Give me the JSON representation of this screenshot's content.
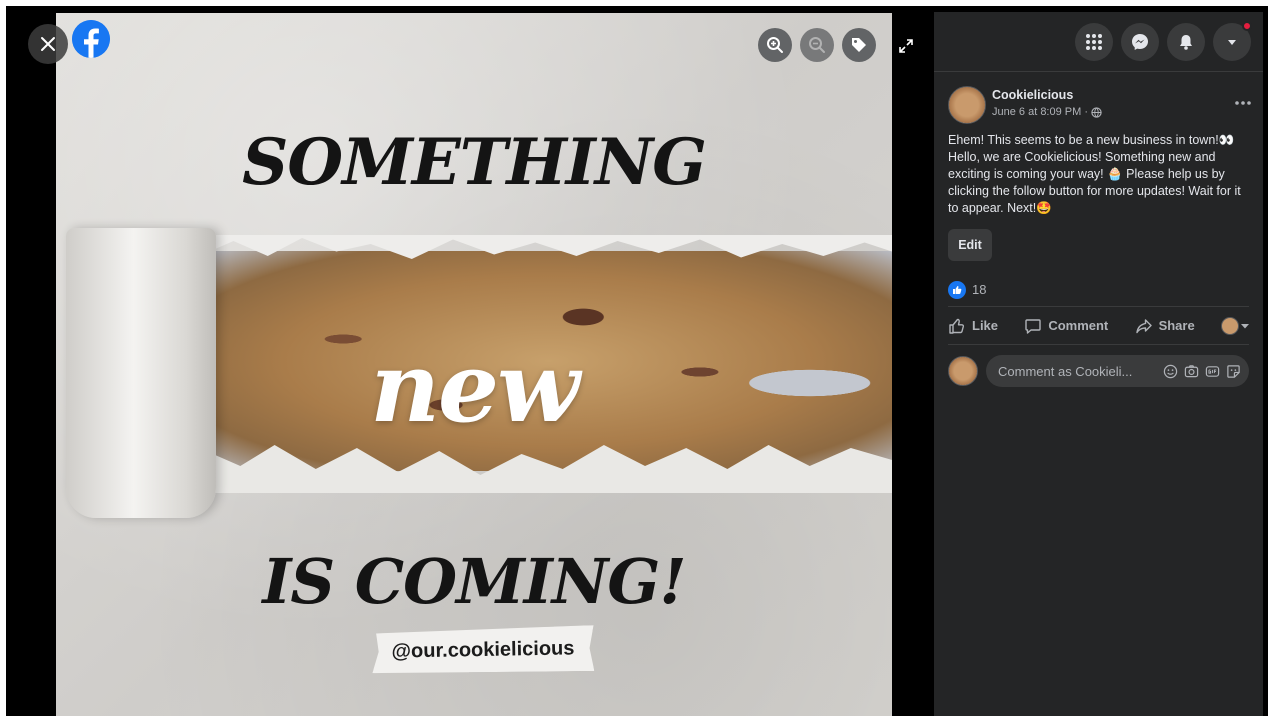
{
  "photo": {
    "headline_top": "SOMETHING",
    "headline_middle": "new",
    "headline_bottom": "IS COMING!",
    "handle": "@our.cookielicious"
  },
  "viewer_controls": {
    "close_icon": "close-icon",
    "logo_icon": "facebook-logo-icon",
    "tools": [
      "zoom-in-icon",
      "zoom-out-icon",
      "tag-icon"
    ],
    "expand_icon": "expand-icon"
  },
  "topbar": {
    "icons": [
      "menu-grid-icon",
      "messenger-icon",
      "bell-icon",
      "chevron-down-icon"
    ],
    "notification_color": "#e41e3f"
  },
  "post": {
    "page_name": "Cookielicious",
    "timestamp": "June 6 at 8:09 PM ·",
    "text": "Ehem! This seems to be a new business in town!👀 Hello, we are Cookielicious! Something new and exciting is coming your way! 🧁 Please help us by clicking the follow button for more updates! Wait for it to appear. Next!🤩",
    "edit_label": "Edit",
    "reaction_count": "18",
    "actions": {
      "like": "Like",
      "comment": "Comment",
      "share": "Share"
    },
    "comment_placeholder": "Comment as Cookieli..."
  },
  "colors": {
    "facebook_blue": "#1877f2",
    "panel_bg": "#242526",
    "panel_surface": "#3a3b3c"
  }
}
